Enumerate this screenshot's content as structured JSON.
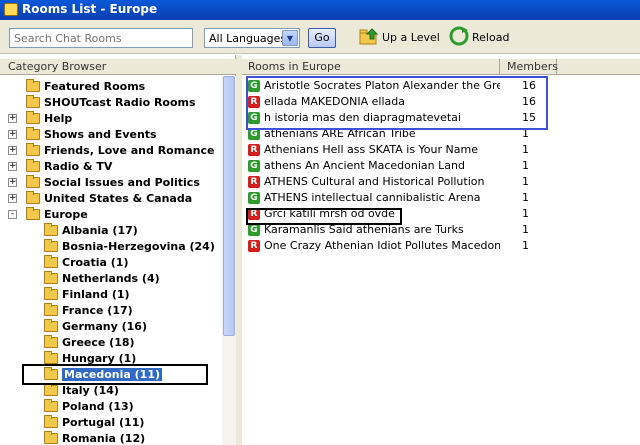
{
  "window": {
    "title": "Rooms List - Europe"
  },
  "toolbar": {
    "search_placeholder": "Search Chat Rooms",
    "language_value": "All Languages",
    "go_label": "Go",
    "up_level_label": "Up a Level",
    "reload_label": "Reload"
  },
  "tree": {
    "header": "Category Browser",
    "items": [
      {
        "label": "Featured Rooms",
        "level": 0,
        "expander": ""
      },
      {
        "label": "SHOUTcast Radio Rooms",
        "level": 0,
        "expander": ""
      },
      {
        "label": "Help",
        "level": 0,
        "expander": "+"
      },
      {
        "label": "Shows and Events",
        "level": 0,
        "expander": "+"
      },
      {
        "label": "Friends, Love and Romance",
        "level": 0,
        "expander": "+"
      },
      {
        "label": "Radio & TV",
        "level": 0,
        "expander": "+"
      },
      {
        "label": "Social Issues and Politics",
        "level": 0,
        "expander": "+"
      },
      {
        "label": "United States & Canada",
        "level": 0,
        "expander": "+"
      },
      {
        "label": "Europe",
        "level": 0,
        "expander": "-"
      },
      {
        "label": "Albania (17)",
        "level": 1,
        "expander": ""
      },
      {
        "label": "Bosnia-Herzegovina (24)",
        "level": 1,
        "expander": ""
      },
      {
        "label": "Croatia (1)",
        "level": 1,
        "expander": ""
      },
      {
        "label": "Netherlands (4)",
        "level": 1,
        "expander": ""
      },
      {
        "label": "Finland (1)",
        "level": 1,
        "expander": ""
      },
      {
        "label": "France (17)",
        "level": 1,
        "expander": ""
      },
      {
        "label": "Germany (16)",
        "level": 1,
        "expander": ""
      },
      {
        "label": "Greece (18)",
        "level": 1,
        "expander": ""
      },
      {
        "label": "Hungary (1)",
        "level": 1,
        "expander": ""
      },
      {
        "label": "Macedonia (11)",
        "level": 1,
        "expander": "",
        "selected": true
      },
      {
        "label": "Italy (14)",
        "level": 1,
        "expander": ""
      },
      {
        "label": "Poland (13)",
        "level": 1,
        "expander": ""
      },
      {
        "label": "Portugal (11)",
        "level": 1,
        "expander": ""
      },
      {
        "label": "Romania (12)",
        "level": 1,
        "expander": ""
      }
    ]
  },
  "rooms": {
    "col_name": "Rooms in Europe",
    "col_members": "Members",
    "rows": [
      {
        "badge": "G",
        "name": "Aristotle Socrates Platon Alexander the Great",
        "members": "16"
      },
      {
        "badge": "R",
        "name": "ellada MAKEDONIA ellada",
        "members": "16"
      },
      {
        "badge": "G",
        "name": "h istoria mas den diapragmatevetai",
        "members": "15"
      },
      {
        "badge": "G",
        "name": "athenians ARE African Tribe",
        "members": "1"
      },
      {
        "badge": "R",
        "name": "Athenians Hell ass SKATA is Your Name",
        "members": "1"
      },
      {
        "badge": "G",
        "name": "athens An Ancient Macedonian Land",
        "members": "1"
      },
      {
        "badge": "R",
        "name": "ATHENS Cultural and Historical Pollution",
        "members": "1"
      },
      {
        "badge": "G",
        "name": "ATHENS intellectual cannibalistic Arena",
        "members": "1"
      },
      {
        "badge": "R",
        "name": "Grci katili mrsh od ovde",
        "members": "1"
      },
      {
        "badge": "G",
        "name": "Karamanlis Said athenians are Turks",
        "members": "1"
      },
      {
        "badge": "R",
        "name": "One Crazy Athenian Idiot Pollutes Macedonia ...",
        "members": "1"
      }
    ]
  },
  "colors": {
    "accent": "#316ac5",
    "highlight_blue": "#3d52d6",
    "badge_green": "#2d9b2d",
    "badge_red": "#d31e1e"
  }
}
